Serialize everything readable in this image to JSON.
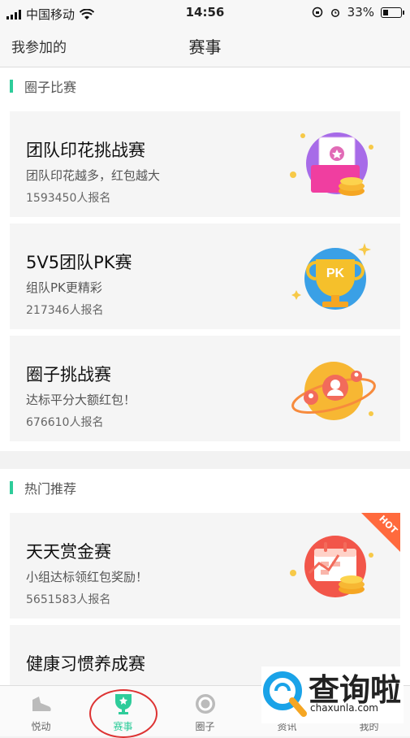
{
  "status": {
    "carrier": "中国移动",
    "time": "14:56",
    "battery": "33%"
  },
  "nav": {
    "left_link": "我参加的",
    "title": "赛事"
  },
  "sections": [
    {
      "title": "圈子比赛",
      "cards": [
        {
          "title": "团队印花挑战赛",
          "subtitle": "团队印花越多，红包越大",
          "count": "1593450人报名"
        },
        {
          "title": "5V5团队PK赛",
          "subtitle": "组队PK更精彩",
          "count": "217346人报名"
        },
        {
          "title": "圈子挑战赛",
          "subtitle": "达标平分大额红包！",
          "count": "676610人报名"
        }
      ]
    },
    {
      "title": "热门推荐",
      "cards": [
        {
          "title": "天天赏金赛",
          "subtitle": "小组达标领红包奖励！",
          "count": "5651583人报名",
          "badge": "HOT"
        },
        {
          "title": "健康习惯养成赛",
          "subtitle": "",
          "count": ""
        }
      ]
    }
  ],
  "pk_text": "PK",
  "tabs": [
    {
      "label": "悦动",
      "icon": "shoe-icon"
    },
    {
      "label": "赛事",
      "icon": "trophy-icon",
      "active": true
    },
    {
      "label": "圈子",
      "icon": "circle-icon"
    },
    {
      "label": "资讯",
      "icon": "news-icon"
    },
    {
      "label": "我的",
      "icon": "profile-icon"
    }
  ],
  "watermark": {
    "big": "查询啦",
    "small": "chaxunla.com"
  },
  "colors": {
    "accent": "#2ecc9a",
    "hot": "#ff6a3d"
  }
}
